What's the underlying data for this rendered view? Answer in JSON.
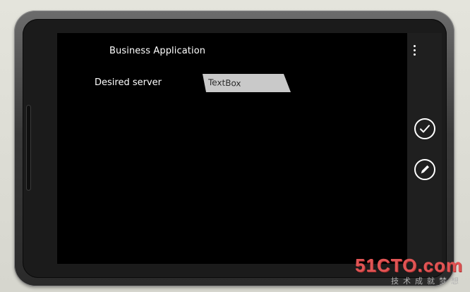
{
  "app": {
    "title": "Business Application"
  },
  "form": {
    "server_label": "Desired server",
    "server_value": "TextBox"
  },
  "appbar": {
    "buttons": [
      {
        "icon": "check-icon"
      },
      {
        "icon": "edit-icon"
      }
    ]
  },
  "watermark": {
    "main": "51CTO.com",
    "sub": "技术成就梦想"
  }
}
